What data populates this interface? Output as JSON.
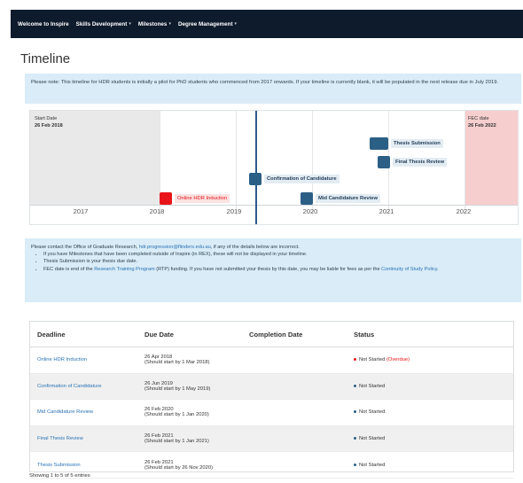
{
  "nav": {
    "items": [
      {
        "label": "Welcome to Inspire",
        "dropdown": false
      },
      {
        "label": "Skills Development",
        "dropdown": true
      },
      {
        "label": "Milestones",
        "dropdown": true
      },
      {
        "label": "Degree Management",
        "dropdown": true
      }
    ]
  },
  "page": {
    "title": "Timeline",
    "notice": "Please note: This timeline for HDR students is initially a pilot for PhD students who commenced from 2017 onwards. If your timeline is currently blank, it will be populated in the next release due in July 2019."
  },
  "timeline": {
    "start_label": "Start Date",
    "start_date": "26 Feb 2018",
    "fec_label": "FEC date",
    "fec_date": "26 Feb 2022",
    "years": [
      "2017",
      "2018",
      "2019",
      "2020",
      "2021",
      "2022"
    ],
    "milestones": [
      {
        "label": "Online HDR Induction",
        "status": "overdue"
      },
      {
        "label": "Confirmation of Candidature",
        "status": "not-started"
      },
      {
        "label": "Mid Candidature Review",
        "status": "not-started"
      },
      {
        "label": "Final Thesis Review",
        "status": "not-started"
      },
      {
        "label": "Thesis Submission",
        "status": "not-started"
      }
    ]
  },
  "contact": {
    "intro_before": "Please contact the Office of Graduate Research,",
    "email": "hdr.progression@flinders.edu.au",
    "intro_after": ", if any of the details below are incorrect.",
    "bullet1": "If you have Milestones that have been completed outside of Inspire (in REX), these will not be displayed in your timeline.",
    "bullet2": "Thesis Submission is your thesis due date.",
    "bullet3_before": "FEC date is end of the",
    "bullet3_link": "Research Training Program",
    "bullet3_after": "(RTP) funding. If you have not submitted your thesis by this date, you may be liable for fees as per the",
    "bullet3_link2": "Continuity of Study Policy",
    "bullet3_end": "."
  },
  "table": {
    "headers": [
      "Deadline",
      "Due Date",
      "Completion Date",
      "Status"
    ],
    "rows": [
      {
        "deadline": "Online HDR Induction",
        "due": "26 Apr 2018",
        "due_sub": "(Should start by 1 Mar 2018)",
        "completion": "",
        "status": "Not Started",
        "status_extra": "(Overdue)",
        "dot_color": "#e8141a"
      },
      {
        "deadline": "Confirmation of Candidature",
        "due": "26 Jun 2019",
        "due_sub": "(Should start by 1 May 2019)",
        "completion": "",
        "status": "Not Started",
        "status_extra": "",
        "dot_color": "#2c5f85"
      },
      {
        "deadline": "Mid Candidature Review",
        "due": "26 Feb 2020",
        "due_sub": "(Should start by 1 Jan 2020)",
        "completion": "",
        "status": "Not Started",
        "status_extra": "",
        "dot_color": "#2c5f85"
      },
      {
        "deadline": "Final Thesis Review",
        "due": "26 Feb 2021",
        "due_sub": "(Should start by 1 Jan 2021)",
        "completion": "",
        "status": "Not Started",
        "status_extra": "",
        "dot_color": "#2c5f85"
      },
      {
        "deadline": "Thesis Submission",
        "due": "26 Feb 2021",
        "due_sub": "(Should start by 26 Nov 2020)",
        "completion": "",
        "status": "Not Started",
        "status_extra": "",
        "dot_color": "#2c5f85"
      }
    ],
    "footer": "Showing 1 to 5 of 5 entries"
  }
}
